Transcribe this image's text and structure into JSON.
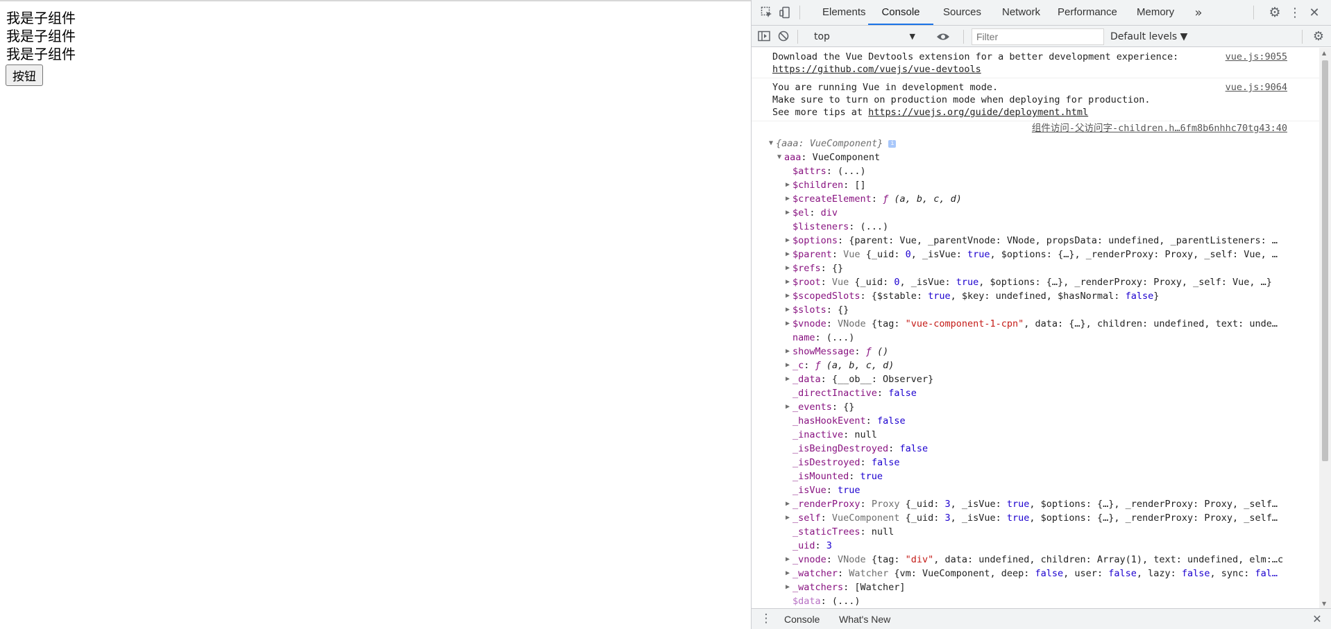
{
  "page": {
    "lines": [
      "我是子组件",
      "我是子组件",
      "我是子组件"
    ],
    "button_label": "按钮"
  },
  "devtools": {
    "tabs": [
      "Elements",
      "Console",
      "Sources",
      "Network",
      "Performance",
      "Memory"
    ],
    "active_tab": "Console",
    "more_tabs_icon": "double-chevron-icon",
    "context": "top",
    "filter_placeholder": "Filter",
    "levels": "Default levels ▼",
    "drawer_tabs": [
      "Console",
      "What's New"
    ]
  },
  "messages": [
    {
      "lines": [
        "Download the Vue Devtools extension for a better development experience:",
        "https://github.com/vuejs/vue-devtools"
      ],
      "source": "vue.js:9055"
    },
    {
      "lines": [
        "You are running Vue in development mode.",
        "Make sure to turn on production mode when deploying for production.",
        "See more tips at https://vuejs.org/guide/deployment.html"
      ],
      "source": "vue.js:9064"
    }
  ],
  "log_source": "组件访问-父访问字-children.h…6fm8b6nhhc70tg43:40",
  "tree": [
    {
      "d": 0,
      "t": "down",
      "segs": [
        [
          "o it",
          "{aaa: VueComponent}"
        ]
      ],
      "info": true
    },
    {
      "d": 1,
      "t": "down",
      "segs": [
        [
          "k",
          "aaa"
        ],
        [
          "",
          "："
        ],
        [
          "",
          "VueComponent"
        ]
      ]
    },
    {
      "d": 2,
      "t": "",
      "segs": [
        [
          "k",
          "$attrs"
        ],
        [
          "",
          ": (...)"
        ]
      ]
    },
    {
      "d": 2,
      "t": "right",
      "segs": [
        [
          "k",
          "$children"
        ],
        [
          "",
          ": []"
        ]
      ]
    },
    {
      "d": 2,
      "t": "right",
      "segs": [
        [
          "k",
          "$createElement"
        ],
        [
          "",
          ": "
        ],
        [
          "k it",
          "ƒ"
        ],
        [
          "it",
          " (a, b, c, d)"
        ]
      ]
    },
    {
      "d": 2,
      "t": "right",
      "segs": [
        [
          "k",
          "$el"
        ],
        [
          "",
          ": "
        ],
        [
          "k",
          "div"
        ]
      ]
    },
    {
      "d": 2,
      "t": "",
      "segs": [
        [
          "k",
          "$listeners"
        ],
        [
          "",
          ": (...)"
        ]
      ]
    },
    {
      "d": 2,
      "t": "right",
      "segs": [
        [
          "k",
          "$options"
        ],
        [
          "",
          ": {parent: Vue, _parentVnode: VNode, propsData: undefined, _parentListeners: …"
        ]
      ]
    },
    {
      "d": 2,
      "t": "right",
      "segs": [
        [
          "k",
          "$parent"
        ],
        [
          "",
          ": "
        ],
        [
          "o",
          "Vue"
        ],
        [
          "",
          " {_uid: "
        ],
        [
          "n",
          "0"
        ],
        [
          "",
          ", _isVue: "
        ],
        [
          "n",
          "true"
        ],
        [
          "",
          ", $options: {…}, _renderProxy: Proxy, _self: Vue, …"
        ]
      ]
    },
    {
      "d": 2,
      "t": "right",
      "segs": [
        [
          "k",
          "$refs"
        ],
        [
          "",
          ": {}"
        ]
      ]
    },
    {
      "d": 2,
      "t": "right",
      "segs": [
        [
          "k",
          "$root"
        ],
        [
          "",
          ": "
        ],
        [
          "o",
          "Vue"
        ],
        [
          "",
          " {_uid: "
        ],
        [
          "n",
          "0"
        ],
        [
          "",
          ", _isVue: "
        ],
        [
          "n",
          "true"
        ],
        [
          "",
          ", $options: {…}, _renderProxy: Proxy, _self: Vue, …}"
        ]
      ]
    },
    {
      "d": 2,
      "t": "right",
      "segs": [
        [
          "k",
          "$scopedSlots"
        ],
        [
          "",
          ": {$stable: "
        ],
        [
          "n",
          "true"
        ],
        [
          "",
          ", $key: undefined, $hasNormal: "
        ],
        [
          "n",
          "false"
        ],
        [
          "",
          "}"
        ]
      ]
    },
    {
      "d": 2,
      "t": "right",
      "segs": [
        [
          "k",
          "$slots"
        ],
        [
          "",
          ": {}"
        ]
      ]
    },
    {
      "d": 2,
      "t": "right",
      "segs": [
        [
          "k",
          "$vnode"
        ],
        [
          "",
          ": "
        ],
        [
          "o",
          "VNode"
        ],
        [
          "",
          " {tag: "
        ],
        [
          "s",
          "\"vue-component-1-cpn\""
        ],
        [
          "",
          ", data: {…}, children: undefined, text: unde…"
        ]
      ]
    },
    {
      "d": 2,
      "t": "",
      "segs": [
        [
          "k",
          "name"
        ],
        [
          "",
          ": (...)"
        ]
      ]
    },
    {
      "d": 2,
      "t": "right",
      "segs": [
        [
          "k",
          "showMessage"
        ],
        [
          "",
          ": "
        ],
        [
          "k it",
          "ƒ"
        ],
        [
          "it",
          " ()"
        ]
      ]
    },
    {
      "d": 2,
      "t": "right",
      "segs": [
        [
          "k",
          "_c"
        ],
        [
          "",
          ": "
        ],
        [
          "k it",
          "ƒ"
        ],
        [
          "it",
          " (a, b, c, d)"
        ]
      ]
    },
    {
      "d": 2,
      "t": "right",
      "segs": [
        [
          "k",
          "_data"
        ],
        [
          "",
          ": {__ob__: Observer}"
        ]
      ]
    },
    {
      "d": 2,
      "t": "",
      "segs": [
        [
          "k",
          "_directInactive"
        ],
        [
          "",
          ": "
        ],
        [
          "n",
          "false"
        ]
      ]
    },
    {
      "d": 2,
      "t": "right",
      "segs": [
        [
          "k",
          "_events"
        ],
        [
          "",
          ": {}"
        ]
      ]
    },
    {
      "d": 2,
      "t": "",
      "segs": [
        [
          "k",
          "_hasHookEvent"
        ],
        [
          "",
          ": "
        ],
        [
          "n",
          "false"
        ]
      ]
    },
    {
      "d": 2,
      "t": "",
      "segs": [
        [
          "k",
          "_inactive"
        ],
        [
          "",
          ": null"
        ]
      ]
    },
    {
      "d": 2,
      "t": "",
      "segs": [
        [
          "k",
          "_isBeingDestroyed"
        ],
        [
          "",
          ": "
        ],
        [
          "n",
          "false"
        ]
      ]
    },
    {
      "d": 2,
      "t": "",
      "segs": [
        [
          "k",
          "_isDestroyed"
        ],
        [
          "",
          ": "
        ],
        [
          "n",
          "false"
        ]
      ]
    },
    {
      "d": 2,
      "t": "",
      "segs": [
        [
          "k",
          "_isMounted"
        ],
        [
          "",
          ": "
        ],
        [
          "n",
          "true"
        ]
      ]
    },
    {
      "d": 2,
      "t": "",
      "segs": [
        [
          "k",
          "_isVue"
        ],
        [
          "",
          ": "
        ],
        [
          "n",
          "true"
        ]
      ]
    },
    {
      "d": 2,
      "t": "right",
      "segs": [
        [
          "k",
          "_renderProxy"
        ],
        [
          "",
          ": "
        ],
        [
          "o",
          "Proxy"
        ],
        [
          "",
          " {_uid: "
        ],
        [
          "n",
          "3"
        ],
        [
          "",
          ", _isVue: "
        ],
        [
          "n",
          "true"
        ],
        [
          "",
          ", $options: {…}, _renderProxy: Proxy, _self…"
        ]
      ]
    },
    {
      "d": 2,
      "t": "right",
      "segs": [
        [
          "k",
          "_self"
        ],
        [
          "",
          ": "
        ],
        [
          "o",
          "VueComponent"
        ],
        [
          "",
          " {_uid: "
        ],
        [
          "n",
          "3"
        ],
        [
          "",
          ", _isVue: "
        ],
        [
          "n",
          "true"
        ],
        [
          "",
          ", $options: {…}, _renderProxy: Proxy, _self…"
        ]
      ]
    },
    {
      "d": 2,
      "t": "",
      "segs": [
        [
          "k",
          "_staticTrees"
        ],
        [
          "",
          ": null"
        ]
      ]
    },
    {
      "d": 2,
      "t": "",
      "segs": [
        [
          "k",
          "_uid"
        ],
        [
          "",
          ": "
        ],
        [
          "n",
          "3"
        ]
      ]
    },
    {
      "d": 2,
      "t": "right",
      "segs": [
        [
          "k",
          "_vnode"
        ],
        [
          "",
          ": "
        ],
        [
          "o",
          "VNode"
        ],
        [
          "",
          " {tag: "
        ],
        [
          "s",
          "\"div\""
        ],
        [
          "",
          ", data: undefined, children: Array(1), text: undefined, elm:…c"
        ]
      ]
    },
    {
      "d": 2,
      "t": "right",
      "segs": [
        [
          "k",
          "_watcher"
        ],
        [
          "",
          ": "
        ],
        [
          "o",
          "Watcher"
        ],
        [
          "",
          " {vm: VueComponent, deep: "
        ],
        [
          "n",
          "false"
        ],
        [
          "",
          ", user: "
        ],
        [
          "n",
          "false"
        ],
        [
          "",
          ", lazy: "
        ],
        [
          "n",
          "false"
        ],
        [
          "",
          ", sync: "
        ],
        [
          "n",
          "fal…"
        ]
      ]
    },
    {
      "d": 2,
      "t": "right",
      "segs": [
        [
          "k",
          "_watchers"
        ],
        [
          "",
          ": [Watcher]"
        ]
      ]
    },
    {
      "d": 2,
      "t": "",
      "segs": [
        [
          "kd",
          "$data"
        ],
        [
          "",
          ": (...)"
        ]
      ]
    }
  ]
}
